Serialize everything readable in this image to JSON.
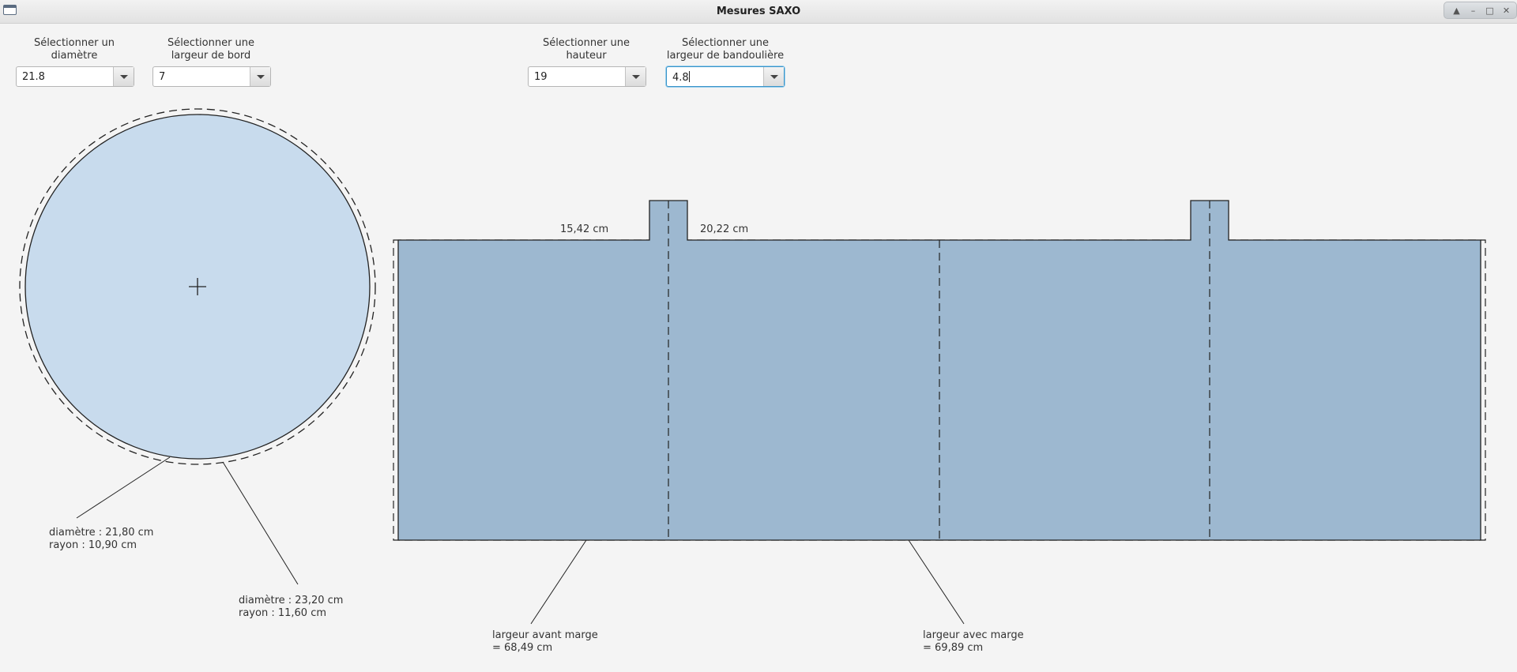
{
  "window": {
    "title": "Mesures SAXO"
  },
  "controls": {
    "diameter": {
      "label_line1": "Sélectionner un",
      "label_line2": "diamètre",
      "value": "21.8"
    },
    "border_width": {
      "label_line1": "Sélectionner une",
      "label_line2": "largeur de bord",
      "value": "7"
    },
    "height": {
      "label_line1": "Sélectionner une",
      "label_line2": "hauteur",
      "value": "19"
    },
    "strap_width": {
      "label_line1": "Sélectionner une",
      "label_line2": "largeur de bandoulière",
      "value": "4.8"
    }
  },
  "circle": {
    "inner_diameter": "diamètre : 21,80 cm",
    "inner_radius": "rayon : 10,90 cm",
    "outer_diameter": "diamètre : 23,20 cm",
    "outer_radius": "rayon : 11,60 cm"
  },
  "pattern": {
    "segment_label_1": "15,42 cm",
    "segment_label_2": "20,22 cm",
    "width_before_line1": "largeur avant marge",
    "width_before_line2": "= 68,49 cm",
    "width_after_line1": "largeur avec marge",
    "width_after_line2": "= 69,89 cm"
  },
  "colors": {
    "circle_fill": "#c8dbed",
    "pattern_fill": "#9db8d0",
    "focus_border": "#3a94c8"
  },
  "icons": {
    "app": "window-icon",
    "controls": [
      "up-arrow-icon",
      "minimize-icon",
      "maximize-icon",
      "close-icon"
    ],
    "combo_arrow": "chevron-down-icon",
    "center": "crosshair-icon"
  }
}
